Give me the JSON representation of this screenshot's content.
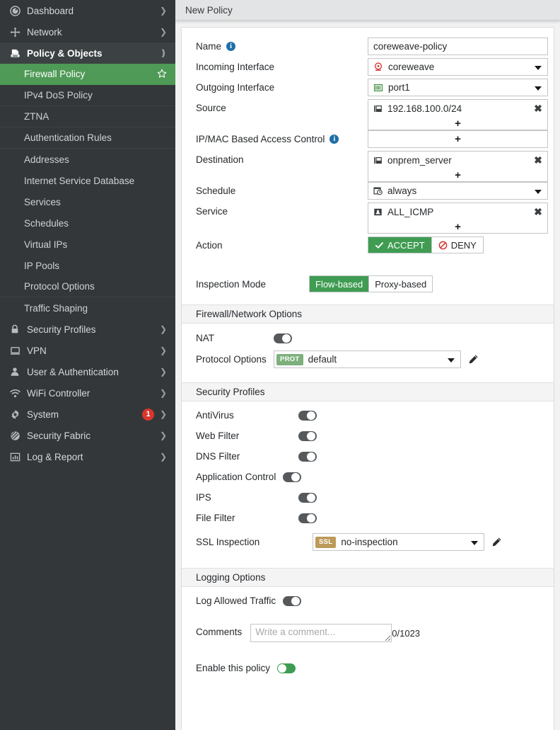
{
  "sidebar": {
    "groups": [
      {
        "label": "Dashboard",
        "icon": "gauge-icon",
        "expandable": true,
        "active": false
      },
      {
        "label": "Network",
        "icon": "network-arrows-icon",
        "expandable": true,
        "active": false
      },
      {
        "label": "Policy & Objects",
        "icon": "policy-document-icon",
        "expandable": true,
        "active": true
      }
    ],
    "policy_items": [
      {
        "label": "Firewall Policy",
        "selected": true,
        "favorite_icon": "star-icon"
      },
      {
        "label": "IPv4 DoS Policy",
        "selected": false
      },
      {
        "label": "ZTNA",
        "selected": false
      },
      {
        "label": "Authentication Rules",
        "selected": false
      },
      {
        "label": "Addresses",
        "selected": false
      },
      {
        "label": "Internet Service Database",
        "selected": false
      },
      {
        "label": "Services",
        "selected": false
      },
      {
        "label": "Schedules",
        "selected": false
      },
      {
        "label": "Virtual IPs",
        "selected": false
      },
      {
        "label": "IP Pools",
        "selected": false
      },
      {
        "label": "Protocol Options",
        "selected": false
      },
      {
        "label": "Traffic Shaping",
        "selected": false
      }
    ],
    "bottom_groups": [
      {
        "label": "Security Profiles",
        "icon": "lock-icon",
        "badge": ""
      },
      {
        "label": "VPN",
        "icon": "monitor-icon",
        "badge": ""
      },
      {
        "label": "User & Authentication",
        "icon": "user-icon",
        "badge": ""
      },
      {
        "label": "WiFi Controller",
        "icon": "wifi-icon",
        "badge": ""
      },
      {
        "label": "System",
        "icon": "gear-icon",
        "badge": "1"
      },
      {
        "label": "Security Fabric",
        "icon": "fabric-icon",
        "badge": ""
      },
      {
        "label": "Log & Report",
        "icon": "chart-bars-icon",
        "badge": ""
      }
    ]
  },
  "header": {
    "title": "New Policy"
  },
  "form": {
    "name": {
      "label": "Name",
      "value": "coreweave-policy",
      "info_icon": "info-icon"
    },
    "incoming_interface": {
      "label": "Incoming Interface",
      "value": "coreweave",
      "icon": "tunnel-interface-icon"
    },
    "outgoing_interface": {
      "label": "Outgoing Interface",
      "value": "port1",
      "icon": "ethernet-port-icon"
    },
    "source": {
      "label": "Source",
      "entries": [
        {
          "value": "192.168.100.0/24",
          "icon": "address-subnet-icon"
        }
      ],
      "add_label": "+",
      "remove_label": "✖"
    },
    "ip_mac_access_control": {
      "label": "IP/MAC Based Access Control",
      "entries": [],
      "add_label": "+",
      "info_icon": "info-icon"
    },
    "destination": {
      "label": "Destination",
      "entries": [
        {
          "value": "onprem_server",
          "icon": "address-subnet-icon"
        }
      ],
      "add_label": "+",
      "remove_label": "✖"
    },
    "schedule": {
      "label": "Schedule",
      "value": "always",
      "icon": "schedule-clock-icon"
    },
    "service": {
      "label": "Service",
      "entries": [
        {
          "value": "ALL_ICMP",
          "icon": "service-icon"
        }
      ],
      "add_label": "+",
      "remove_label": "✖"
    },
    "action": {
      "label": "Action",
      "options": [
        {
          "label": "ACCEPT",
          "selected": true,
          "icon": "check-icon"
        },
        {
          "label": "DENY",
          "selected": false,
          "icon": "deny-icon"
        }
      ]
    },
    "inspection_mode": {
      "label": "Inspection Mode",
      "options": [
        {
          "label": "Flow-based",
          "selected": true
        },
        {
          "label": "Proxy-based",
          "selected": false
        }
      ]
    }
  },
  "firewall_network_options": {
    "section_title": "Firewall/Network Options",
    "nat": {
      "label": "NAT",
      "on": false
    },
    "protocol_options": {
      "label": "Protocol Options",
      "tag": "PROT",
      "value": "default",
      "edit_icon": "pencil-icon"
    }
  },
  "security_profiles": {
    "section_title": "Security Profiles",
    "toggles": [
      {
        "label": "AntiVirus",
        "on": false
      },
      {
        "label": "Web Filter",
        "on": false
      },
      {
        "label": "DNS Filter",
        "on": false
      },
      {
        "label": "Application Control",
        "on": false
      },
      {
        "label": "IPS",
        "on": false
      },
      {
        "label": "File Filter",
        "on": false
      }
    ],
    "ssl_inspection": {
      "label": "SSL Inspection",
      "tag": "SSL",
      "value": "no-inspection",
      "edit_icon": "pencil-icon"
    }
  },
  "logging_options": {
    "section_title": "Logging Options",
    "log_allowed_traffic": {
      "label": "Log Allowed Traffic",
      "on": false
    }
  },
  "comments": {
    "label": "Comments",
    "placeholder": "Write a comment...",
    "value": "",
    "counter": "0/1023"
  },
  "enable_policy": {
    "label": "Enable this policy",
    "on": true
  },
  "colors": {
    "accent_green": "#4e9a56",
    "toggle_on_green": "#3f9c52",
    "badge_red": "#d9352c",
    "sidebar_bg": "#333739",
    "header_bg": "#e3e4e5",
    "tag_prot": "#7cb07c",
    "tag_ssl": "#bd9a59",
    "info_blue": "#1e6fa8"
  }
}
